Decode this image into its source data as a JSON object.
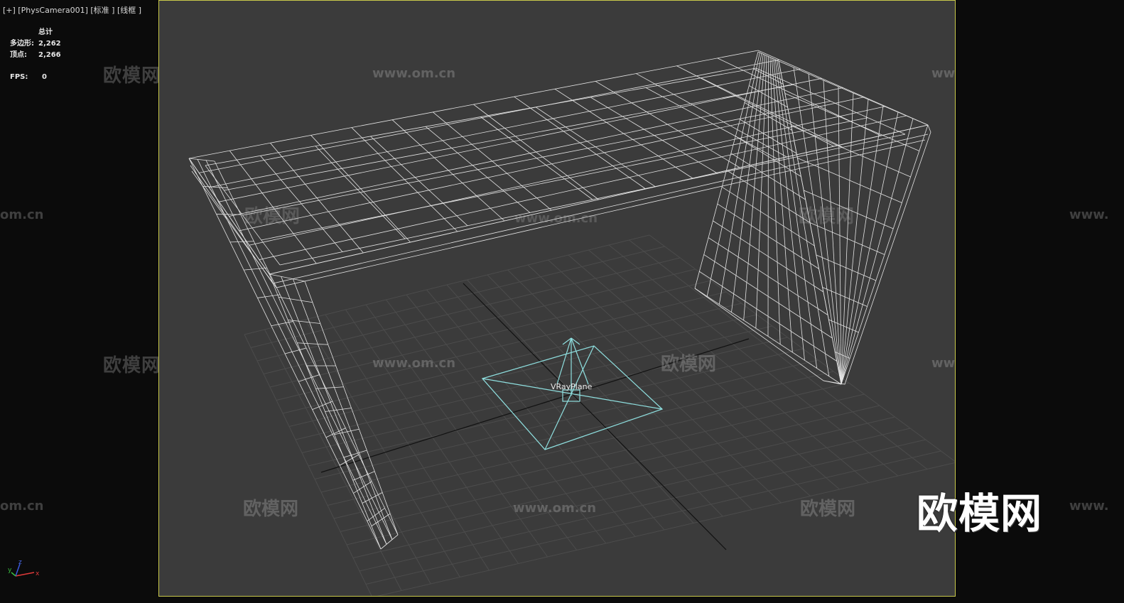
{
  "viewport": {
    "label": "[+] [PhysCamera001] [标准 ] [线框 ]",
    "border_color": "#c9c94a"
  },
  "stats": {
    "header": "总计",
    "polygons_label": "多边形:",
    "polygons_value": "2,262",
    "vertices_label": "顶点:",
    "vertices_value": "2,266",
    "fps_label": "FPS:",
    "fps_value": "0"
  },
  "scene": {
    "light_label": "VRayPlane",
    "light_color": "#8fe0e0",
    "wire_color": "#e8e8e8"
  },
  "axis_tripod": {
    "x": "x",
    "y": "y",
    "z": "z"
  },
  "watermarks": {
    "cn": "欧模网",
    "url": "www.om.cn",
    "url_partial": "om.cn",
    "url_partial_right": "www."
  },
  "logo": "欧模网"
}
